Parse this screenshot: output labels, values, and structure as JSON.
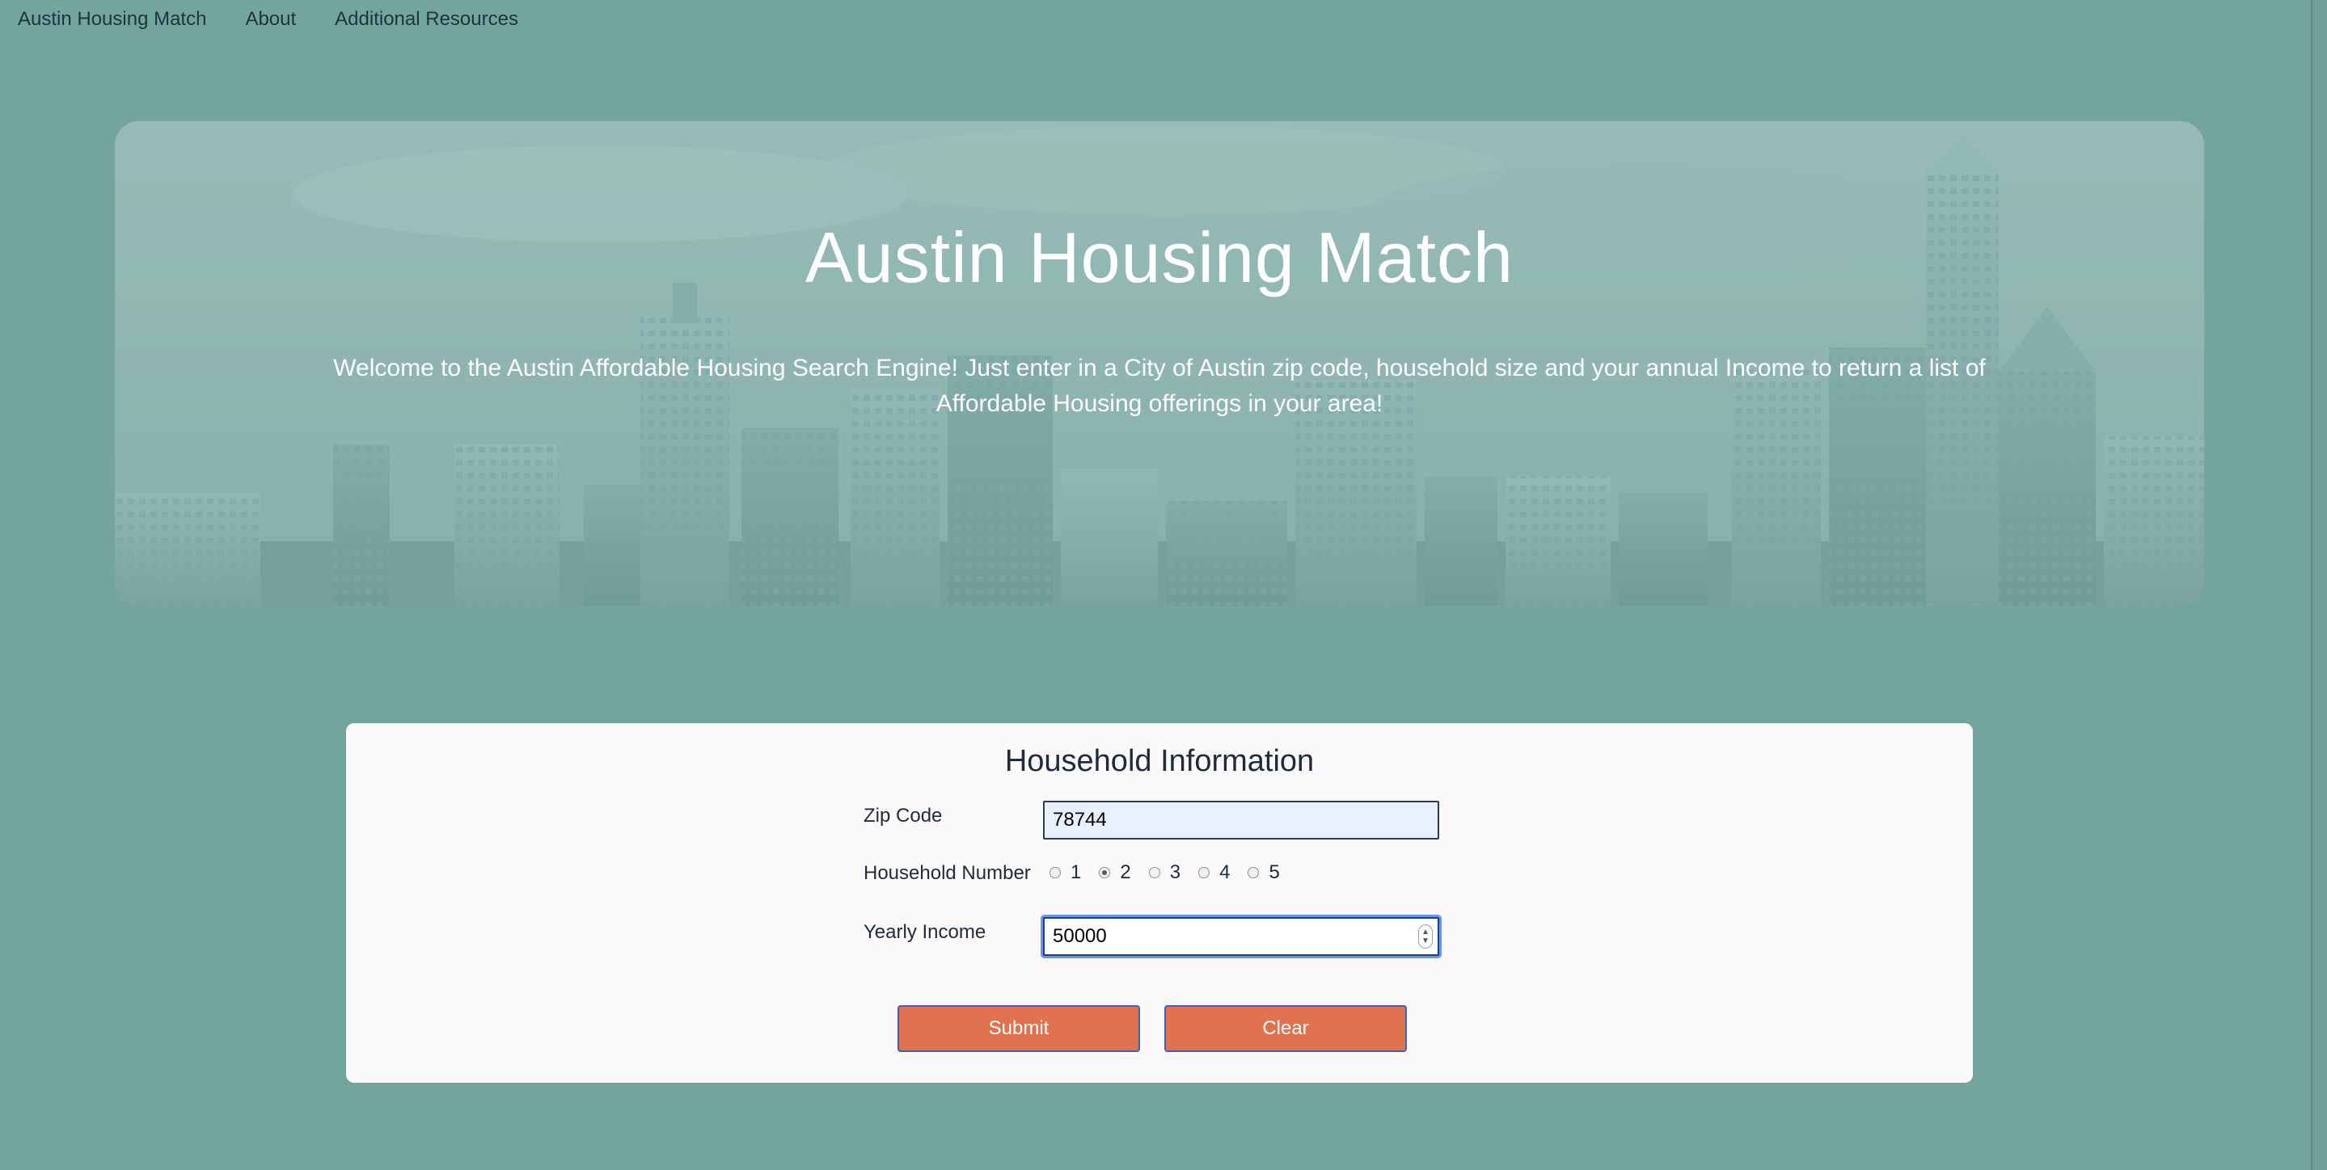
{
  "nav": {
    "items": [
      {
        "label": "Austin Housing Match"
      },
      {
        "label": "About"
      },
      {
        "label": "Additional Resources"
      }
    ]
  },
  "hero": {
    "title": "Austin Housing Match",
    "subtitle": "Welcome to the Austin Affordable Housing Search Engine! Just enter in a City of Austin zip code, household size and your annual Income to return a list of Affordable Housing offerings in your area!"
  },
  "form": {
    "title": "Household Information",
    "zip": {
      "label": "Zip Code",
      "value": "78744"
    },
    "household": {
      "label": "Household Number",
      "options": [
        "1",
        "2",
        "3",
        "4",
        "5"
      ],
      "selected": "2"
    },
    "income": {
      "label": "Yearly Income",
      "value": "50000"
    },
    "buttons": {
      "submit": "Submit",
      "clear": "Clear"
    }
  },
  "colors": {
    "background": "#74a59d",
    "card": "#fcf9fa",
    "button": "#e07250",
    "button_border": "#3c63b8",
    "input_autofill": "#e8f0fe"
  }
}
